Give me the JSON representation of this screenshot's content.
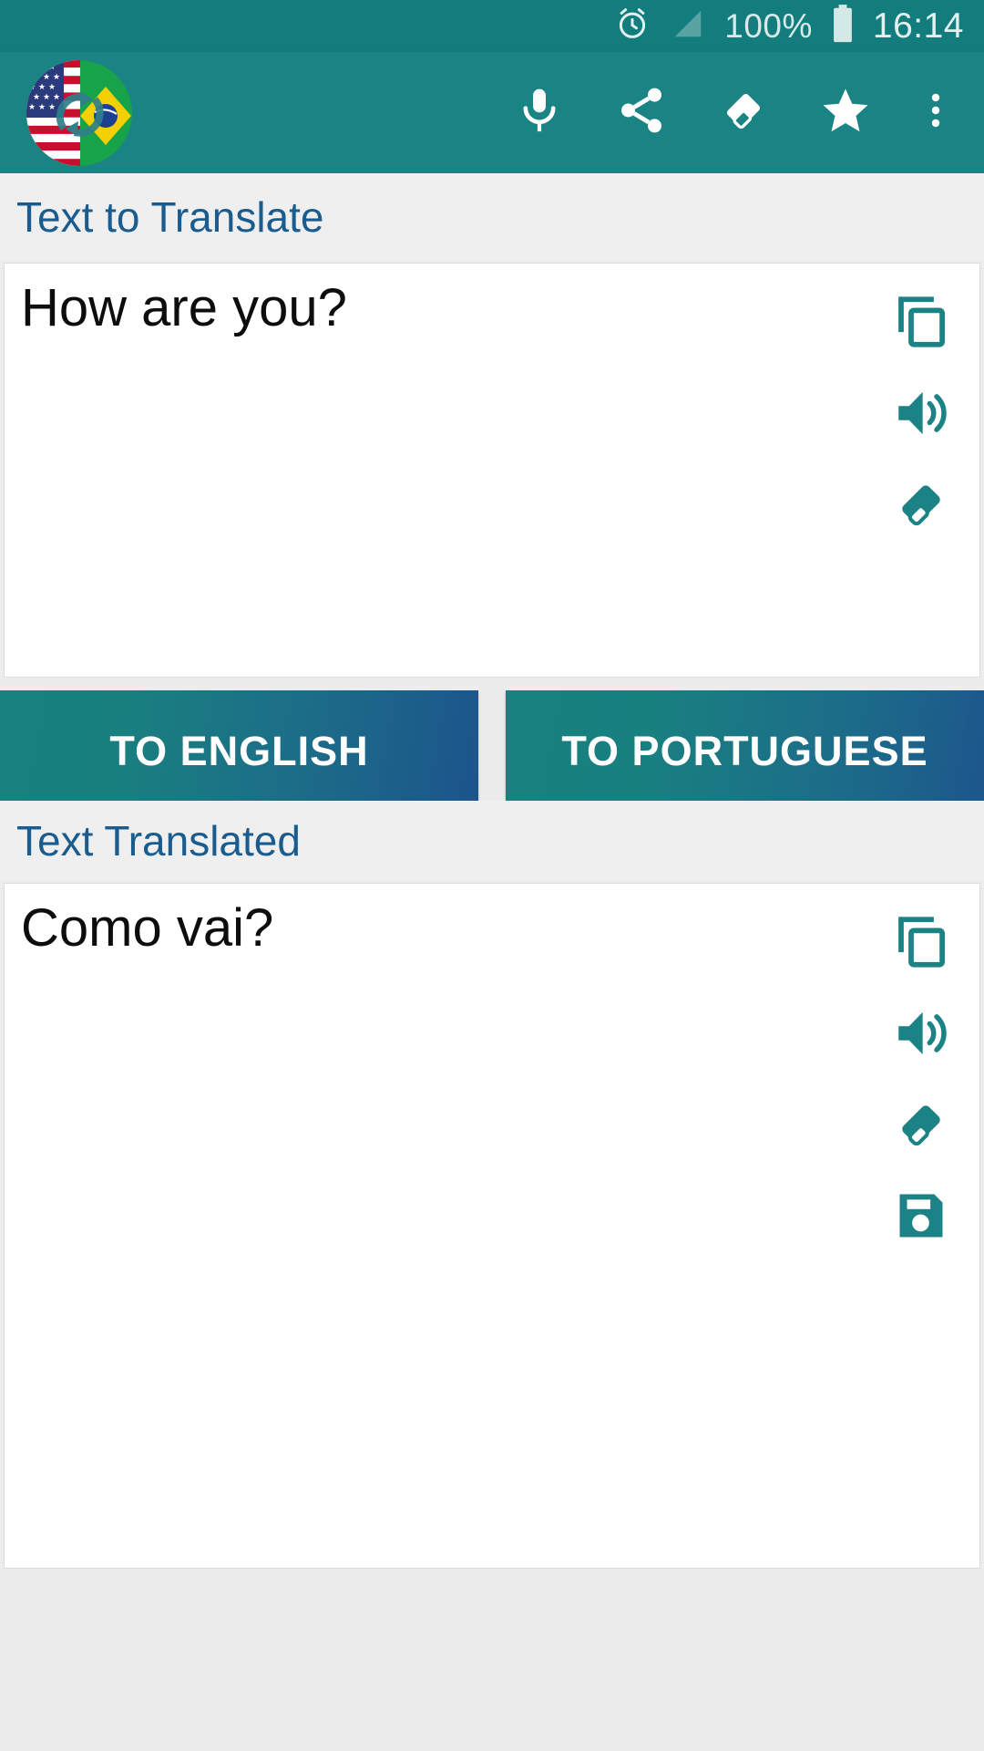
{
  "statusbar": {
    "alarm_icon": "alarm-clock-icon",
    "signal_icon": "signal-bars-icon",
    "battery_percent": "100%",
    "battery_icon": "battery-full-icon",
    "clock": "16:14"
  },
  "toolbar": {
    "app_logo": "app-logo-flags-icon",
    "actions": [
      {
        "name": "voice-input-button",
        "icon": "microphone-icon"
      },
      {
        "name": "share-button",
        "icon": "share-icon"
      },
      {
        "name": "clear-all-button",
        "icon": "eraser-icon"
      },
      {
        "name": "favorite-button",
        "icon": "star-icon"
      },
      {
        "name": "overflow-menu-button",
        "icon": "more-vertical-icon"
      }
    ],
    "bg_color": "#1a8383"
  },
  "input_section": {
    "label": "Text to Translate",
    "text": "How are you?",
    "placeholder": "Text to Translate",
    "actions": [
      {
        "name": "copy-input-button",
        "icon": "copy-icon"
      },
      {
        "name": "speak-input-button",
        "icon": "volume-icon"
      },
      {
        "name": "clear-input-button",
        "icon": "eraser-icon"
      }
    ]
  },
  "translate_buttons": [
    {
      "name": "to-english-button",
      "label": "TO ENGLISH"
    },
    {
      "name": "to-portuguese-button",
      "label": "TO PORTUGUESE"
    }
  ],
  "output_section": {
    "label": "Text Translated",
    "text": "Como vai?",
    "placeholder": "Text Translated",
    "actions": [
      {
        "name": "copy-output-button",
        "icon": "copy-icon"
      },
      {
        "name": "speak-output-button",
        "icon": "volume-icon"
      },
      {
        "name": "clear-output-button",
        "icon": "eraser-icon"
      },
      {
        "name": "save-output-button",
        "icon": "save-floppy-icon"
      }
    ]
  },
  "colors": {
    "primary_teal": "#1a8383",
    "status_teal": "#137d7d",
    "label_blue": "#1b5c8f",
    "icon_teal": "#1b8286",
    "panel_bg": "#ffffff",
    "page_bg": "#ececed"
  }
}
